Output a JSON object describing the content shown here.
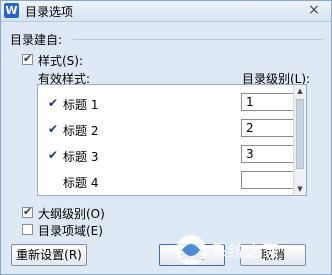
{
  "window": {
    "title": "目录选项",
    "app_icon_letter": "W",
    "close_symbol": "×"
  },
  "source_group": {
    "label": "目录建自:",
    "styles_checkbox": {
      "label": "样式(S):",
      "checked": true
    }
  },
  "styles_list": {
    "col_styles": "有效样式:",
    "col_level": "目录级别(L):",
    "rows": [
      {
        "checked": true,
        "name": "标题 1",
        "level": "1"
      },
      {
        "checked": true,
        "name": "标题 2",
        "level": "2"
      },
      {
        "checked": true,
        "name": "标题 3",
        "level": "3"
      },
      {
        "checked": false,
        "name": "标题 4",
        "level": ""
      }
    ]
  },
  "outline_checkbox": {
    "label": "大纲级别(O)",
    "checked": true
  },
  "fields_checkbox": {
    "label": "目录项域(E)",
    "checked": false
  },
  "buttons": {
    "reset": "重新设置(R)",
    "ok": "确定",
    "cancel": "取消"
  },
  "watermark_text": "系统之家",
  "tick_symbol": "✔",
  "colors": {
    "accent": "#2a64c4",
    "window_bg": "#dfe9f5"
  }
}
